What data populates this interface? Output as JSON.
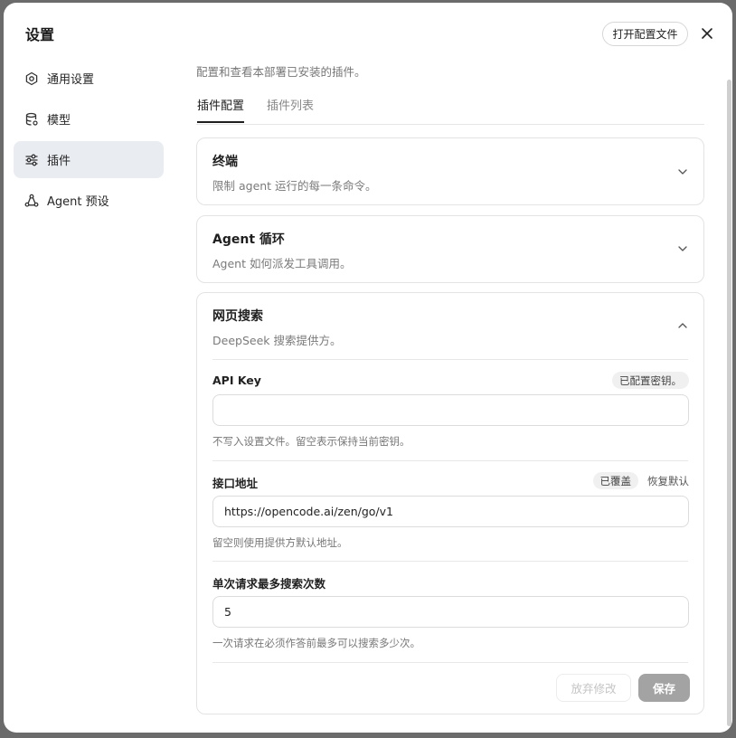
{
  "dialog": {
    "title": "设置",
    "open_config_label": "打开配置文件"
  },
  "sidebar": {
    "items": [
      {
        "label": "通用设置",
        "icon": "gear-icon"
      },
      {
        "label": "模型",
        "icon": "database-icon"
      },
      {
        "label": "插件",
        "icon": "sliders-icon",
        "active": true
      },
      {
        "label": "Agent 预设",
        "icon": "agent-icon"
      }
    ]
  },
  "main": {
    "description": "配置和查看本部署已安装的插件。",
    "tabs": [
      {
        "label": "插件配置",
        "active": true
      },
      {
        "label": "插件列表"
      }
    ],
    "plugins": [
      {
        "title": "终端",
        "subtitle": "限制 agent 运行的每一条命令。",
        "expanded": false
      },
      {
        "title": "Agent 循环",
        "subtitle": "Agent 如何派发工具调用。",
        "expanded": false
      },
      {
        "title": "网页搜索",
        "subtitle": "DeepSeek 搜索提供方。",
        "expanded": true,
        "fields": [
          {
            "label": "API Key",
            "badge": "已配置密钥。",
            "value": "",
            "hint": "不写入设置文件。留空表示保持当前密钥。"
          },
          {
            "label": "接口地址",
            "badge": "已覆盖",
            "reset_label": "恢复默认",
            "value": "https://opencode.ai/zen/go/v1",
            "hint": "留空则使用提供方默认地址。"
          },
          {
            "label": "单次请求最多搜索次数",
            "value": "5",
            "hint": "一次请求在必须作答前最多可以搜索多少次。"
          }
        ],
        "discard_label": "放弃修改",
        "save_label": "保存"
      }
    ]
  },
  "colors": {
    "active_nav_bg": "#e9ecf1",
    "save_button_bg": "#a3a3a3",
    "backdrop": "#6b6b6b"
  }
}
